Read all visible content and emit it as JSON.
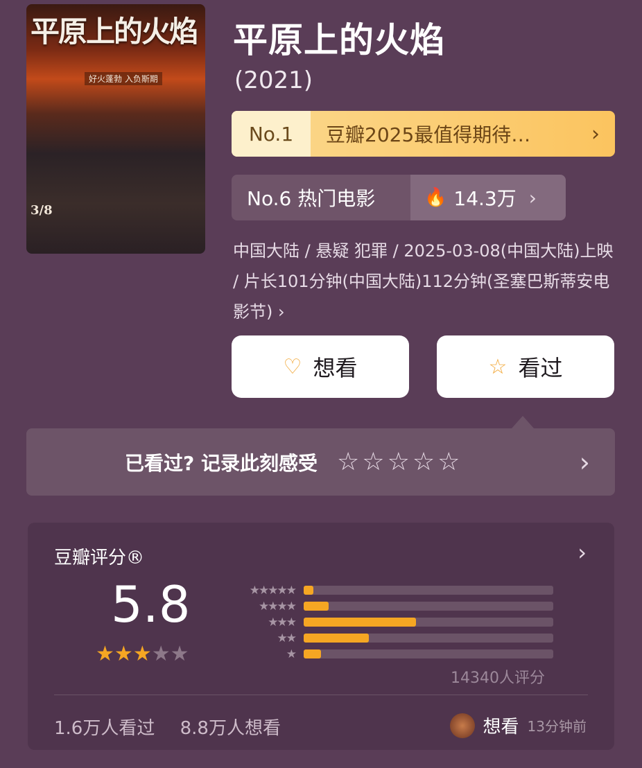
{
  "poster": {
    "title_text": "平原上的火焰",
    "tagline": "好火蓬勃 入负斯期",
    "release_mark": "3/8"
  },
  "movie": {
    "title": "平原上的火焰",
    "year": "(2021)"
  },
  "rankings": {
    "primary": {
      "number": "No.1",
      "label": "豆瓣2025最值得期待…"
    },
    "secondary": {
      "label": "No.6 热门电影",
      "heat": "14.3万"
    }
  },
  "meta": {
    "text": "中国大陆 / 悬疑 犯罪 / 2025-03-08(中国大陆)上映 / 片长101分钟(中国大陆)112分钟(圣塞巴斯蒂安电影节) ›"
  },
  "actions": {
    "want": "想看",
    "seen": "看过"
  },
  "record": {
    "prompt": "已看过? 记录此刻感受"
  },
  "rating": {
    "header": "豆瓣评分®",
    "score": "5.8",
    "stars": 3,
    "max_stars": 5,
    "distribution": [
      {
        "stars": 5,
        "percent": 4
      },
      {
        "stars": 4,
        "percent": 10
      },
      {
        "stars": 3,
        "percent": 45
      },
      {
        "stars": 2,
        "percent": 26
      },
      {
        "stars": 1,
        "percent": 7
      }
    ],
    "count": "14340人评分",
    "watched": "1.6万人看过",
    "wishlist": "8.8万人想看"
  },
  "activity": {
    "action": "想看",
    "time": "13分钟前"
  },
  "colors": {
    "background": "#5a3d57",
    "accent": "#f5a623"
  }
}
